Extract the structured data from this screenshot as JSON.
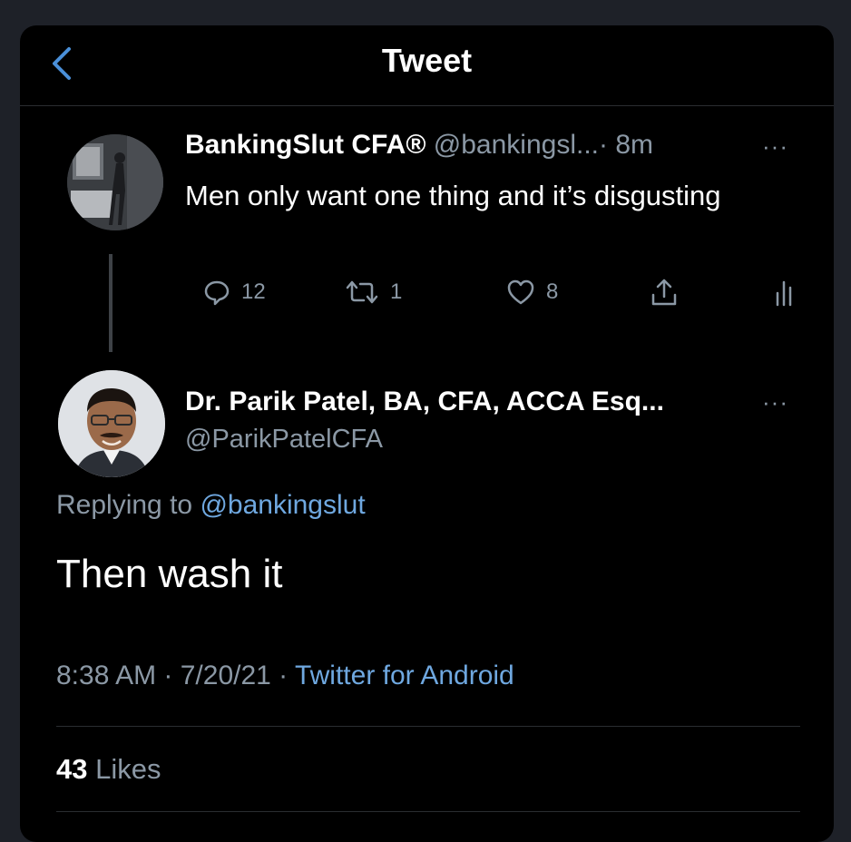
{
  "header": {
    "title": "Tweet"
  },
  "parent_tweet": {
    "name": "BankingSlut CFA®",
    "handle": "@bankingsl...",
    "time": "· 8m",
    "more": "···",
    "text": "Men only want one thing and it’s disgusting",
    "replies": "12",
    "retweets": "1",
    "likes": "8"
  },
  "main_tweet": {
    "name": "Dr. Parik Patel, BA, CFA, ACCA Esq...",
    "handle": "@ParikPatelCFA",
    "more": "···",
    "replying_prefix": "Replying to",
    "replying_handle": "@bankingslut",
    "text": "Then wash it",
    "time": "8:38 AM",
    "date": "· 7/20/21 ·",
    "source": "Twitter for Android",
    "likes_count": "43",
    "likes_label": "Likes"
  },
  "icons": {
    "back": "chevron-left-icon",
    "reply": "reply-icon",
    "retweet": "retweet-icon",
    "like": "heart-icon",
    "share": "share-icon",
    "analytics": "analytics-icon"
  },
  "colors": {
    "background": "#000000",
    "text": "#ffffff",
    "secondary": "#8b98a5",
    "accent": "#1d9bf0"
  }
}
